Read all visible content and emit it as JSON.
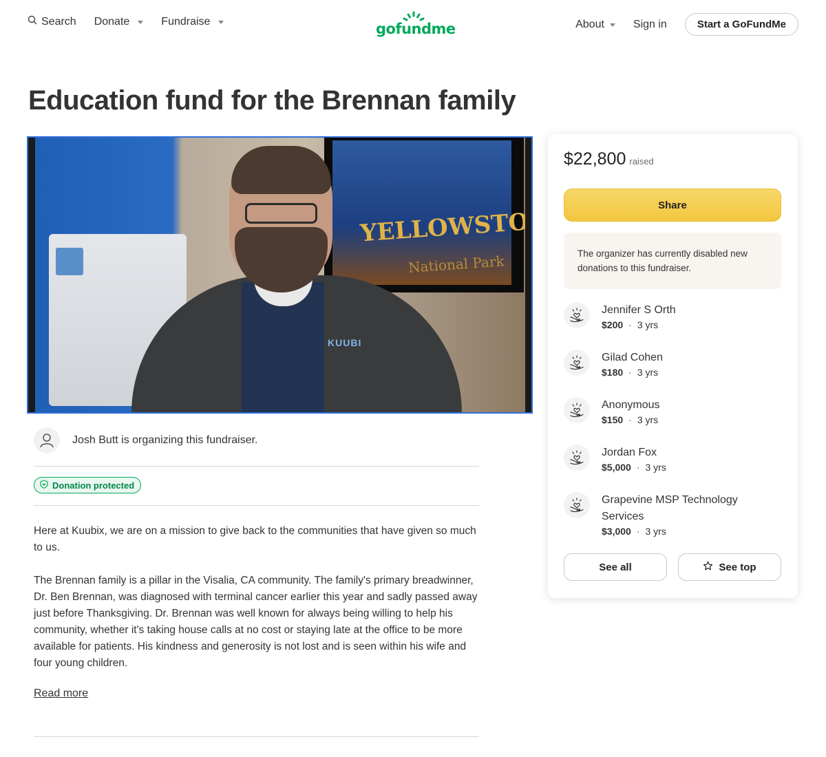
{
  "header": {
    "search_label": "Search",
    "donate_label": "Donate",
    "fundraise_label": "Fundraise",
    "logo_text": "gofundme",
    "about_label": "About",
    "signin_label": "Sign in",
    "start_label": "Start a GoFundMe"
  },
  "page": {
    "title": "Education fund for the Brennan family"
  },
  "video": {
    "poster_word": "YELLOWSTONE",
    "poster_sub": "National Park",
    "shirt_logo": "KUUBI"
  },
  "organizer": {
    "text": "Josh Butt is organizing this fundraiser."
  },
  "badge": {
    "protected_label": "Donation protected"
  },
  "story": {
    "paragraphs": [
      "Here at Kuubix, we are on a mission to give back to the communities that have given so much to us.",
      "The Brennan family is a pillar in the Visalia, CA community. The family's primary breadwinner, Dr. Ben Brennan, was diagnosed with terminal cancer earlier this year and sadly passed away just before Thanksgiving. Dr. Brennan was well known for always being willing to help his community, whether it's taking house calls at no cost or staying late at the office to be more available for patients. His kindness and generosity is not lost and is seen within his wife and four young children."
    ],
    "read_more": "Read more"
  },
  "sidebar": {
    "raised_amount": "$22,800",
    "raised_label": "raised",
    "share_label": "Share",
    "notice": "The organizer has currently disabled new donations to this fundraiser.",
    "donors": [
      {
        "name": "Jennifer S Orth",
        "amount": "$200",
        "time": "3 yrs"
      },
      {
        "name": "Gilad Cohen",
        "amount": "$180",
        "time": "3 yrs"
      },
      {
        "name": "Anonymous",
        "amount": "$150",
        "time": "3 yrs"
      },
      {
        "name": "Jordan Fox",
        "amount": "$5,000",
        "time": "3 yrs"
      },
      {
        "name": "Grapevine MSP Technology Services",
        "amount": "$3,000",
        "time": "3 yrs"
      }
    ],
    "see_all_label": "See all",
    "see_top_label": "See top"
  },
  "colors": {
    "brand_green": "#02a95c",
    "share_yellow": "#f3c63f",
    "video_border": "#2f6fdb"
  },
  "icons": {
    "search": "search-icon",
    "donor": "donor-heart-hand-icon",
    "organizer": "user-icon",
    "shield": "shield-icon",
    "star": "star-icon"
  }
}
